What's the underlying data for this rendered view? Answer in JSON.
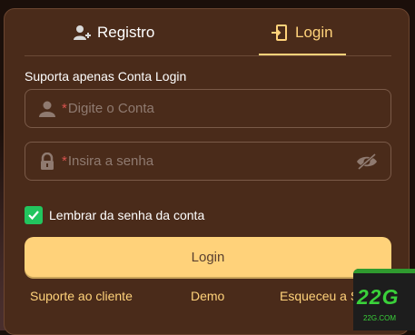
{
  "tabs": {
    "register_label": "Registro",
    "login_label": "Login"
  },
  "form": {
    "hint": "Suporta apenas Conta Login",
    "account_required_mark": "*",
    "account_placeholder": "Digite o Conta",
    "password_required_mark": "*",
    "password_placeholder": "Insira a senha",
    "remember_label": "Lembrar da senha da conta",
    "remember_checked": true,
    "submit_label": "Login"
  },
  "footer": {
    "support_label": "Suporte ao cliente",
    "demo_label": "Demo",
    "forgot_label": "Esqueceu a S"
  },
  "badge": {
    "logo_text": "22G",
    "logo_sub": "22G.COM"
  },
  "colors": {
    "accent": "#ffd27a",
    "panel": "#4a2b1a",
    "checkbox": "#22c55e",
    "required": "#d9534f"
  },
  "icons": {
    "register_tab": "user-plus-icon",
    "login_tab": "door-enter-icon",
    "account_field": "user-icon",
    "password_field": "lock-icon",
    "password_toggle": "eye-slash-icon",
    "checkbox": "check-icon"
  }
}
